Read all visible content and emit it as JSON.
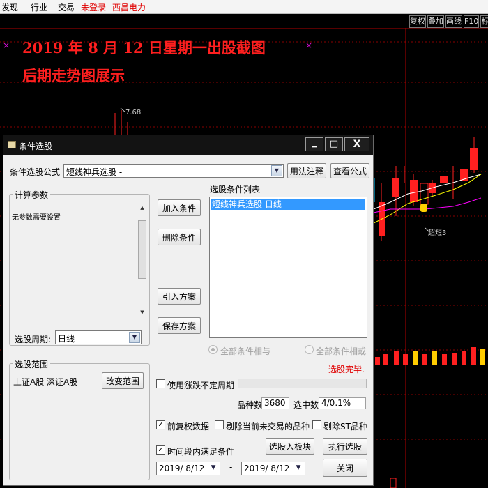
{
  "menubar": {
    "items": [
      "发现",
      "行业",
      "交易"
    ],
    "login": "未登录",
    "stock_name": "西昌电力",
    "right_buttons": [
      "复权",
      "叠加",
      "画线",
      "F10",
      "标"
    ]
  },
  "chart": {
    "title_line1": "2019 年 8 月 12 日星期一出股截图",
    "title_line2": "后期走势图展示",
    "high_marker": "7.68",
    "signal_label": "超短3",
    "cross_marker": "×",
    "colors": {
      "up": "#ff2020",
      "down": "#00c8ff",
      "ma1": "#ffffff",
      "ma2": "#ffff00",
      "ma3": "#ff00ff",
      "vol_up": "#ff2020",
      "vol_flat": "#ffcc00"
    }
  },
  "dialog": {
    "title": "条件选股",
    "window_buttons": {
      "minimize": "▁",
      "maximize": "□",
      "close": "X"
    },
    "formula_label": "条件选股公式",
    "formula_value": "短线神兵选股 -",
    "btn_usage_note": "用法注释",
    "btn_view_formula": "查看公式",
    "params_group_title": "计算参数",
    "params_text": "无参数需要设置",
    "period_label": "选股周期:",
    "period_value": "日线",
    "btn_add_condition": "加入条件",
    "btn_remove_condition": "删除条件",
    "btn_import_scheme": "引入方案",
    "btn_save_scheme": "保存方案",
    "condition_list_label": "选股条件列表",
    "condition_items": [
      "短线神兵选股  日线"
    ],
    "radio_all_and": "全部条件相与",
    "radio_all_or": "全部条件相或",
    "status_text": "选股完毕.",
    "scope_group_title": "选股范围",
    "scope_value": "上证A股 深证A股",
    "btn_change_scope": "改变范围",
    "use_limit_period": "使用涨跌不定周期",
    "count_label": "品种数",
    "count_value": "3680",
    "selected_label": "选中数",
    "selected_value": "4/0.1%",
    "prior_adjust": "前复权数据",
    "exclude_untraded": "剔除当前未交易的品种",
    "exclude_st": "剔除ST品种",
    "time_range_check": "时间段内满足条件",
    "btn_to_block": "选股入板块",
    "btn_execute": "执行选股",
    "date_from": "2019/ 8/12",
    "date_sep": "-",
    "date_to": "2019/ 8/12",
    "btn_close": "关闭"
  }
}
